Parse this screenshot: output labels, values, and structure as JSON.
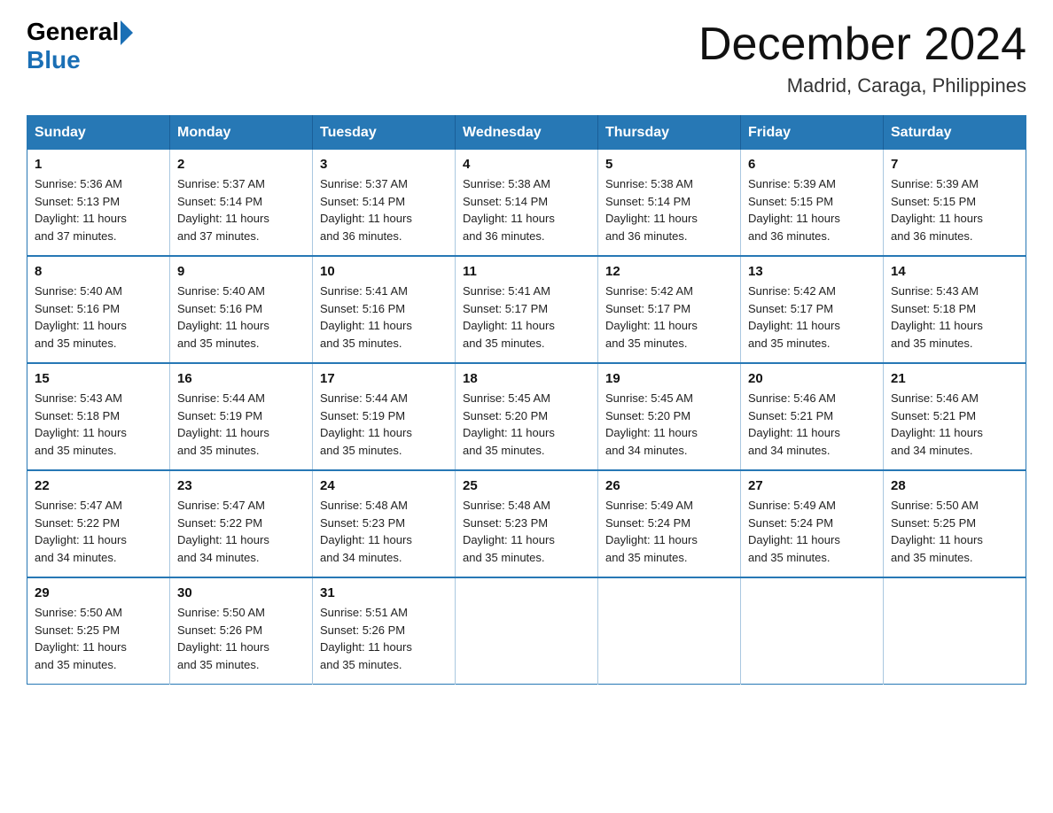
{
  "logo": {
    "general": "General",
    "blue": "Blue"
  },
  "title": {
    "month_year": "December 2024",
    "location": "Madrid, Caraga, Philippines"
  },
  "header_days": [
    "Sunday",
    "Monday",
    "Tuesday",
    "Wednesday",
    "Thursday",
    "Friday",
    "Saturday"
  ],
  "weeks": [
    [
      {
        "day": "1",
        "sunrise": "5:36 AM",
        "sunset": "5:13 PM",
        "daylight": "11 hours and 37 minutes."
      },
      {
        "day": "2",
        "sunrise": "5:37 AM",
        "sunset": "5:14 PM",
        "daylight": "11 hours and 37 minutes."
      },
      {
        "day": "3",
        "sunrise": "5:37 AM",
        "sunset": "5:14 PM",
        "daylight": "11 hours and 36 minutes."
      },
      {
        "day": "4",
        "sunrise": "5:38 AM",
        "sunset": "5:14 PM",
        "daylight": "11 hours and 36 minutes."
      },
      {
        "day": "5",
        "sunrise": "5:38 AM",
        "sunset": "5:14 PM",
        "daylight": "11 hours and 36 minutes."
      },
      {
        "day": "6",
        "sunrise": "5:39 AM",
        "sunset": "5:15 PM",
        "daylight": "11 hours and 36 minutes."
      },
      {
        "day": "7",
        "sunrise": "5:39 AM",
        "sunset": "5:15 PM",
        "daylight": "11 hours and 36 minutes."
      }
    ],
    [
      {
        "day": "8",
        "sunrise": "5:40 AM",
        "sunset": "5:16 PM",
        "daylight": "11 hours and 35 minutes."
      },
      {
        "day": "9",
        "sunrise": "5:40 AM",
        "sunset": "5:16 PM",
        "daylight": "11 hours and 35 minutes."
      },
      {
        "day": "10",
        "sunrise": "5:41 AM",
        "sunset": "5:16 PM",
        "daylight": "11 hours and 35 minutes."
      },
      {
        "day": "11",
        "sunrise": "5:41 AM",
        "sunset": "5:17 PM",
        "daylight": "11 hours and 35 minutes."
      },
      {
        "day": "12",
        "sunrise": "5:42 AM",
        "sunset": "5:17 PM",
        "daylight": "11 hours and 35 minutes."
      },
      {
        "day": "13",
        "sunrise": "5:42 AM",
        "sunset": "5:17 PM",
        "daylight": "11 hours and 35 minutes."
      },
      {
        "day": "14",
        "sunrise": "5:43 AM",
        "sunset": "5:18 PM",
        "daylight": "11 hours and 35 minutes."
      }
    ],
    [
      {
        "day": "15",
        "sunrise": "5:43 AM",
        "sunset": "5:18 PM",
        "daylight": "11 hours and 35 minutes."
      },
      {
        "day": "16",
        "sunrise": "5:44 AM",
        "sunset": "5:19 PM",
        "daylight": "11 hours and 35 minutes."
      },
      {
        "day": "17",
        "sunrise": "5:44 AM",
        "sunset": "5:19 PM",
        "daylight": "11 hours and 35 minutes."
      },
      {
        "day": "18",
        "sunrise": "5:45 AM",
        "sunset": "5:20 PM",
        "daylight": "11 hours and 35 minutes."
      },
      {
        "day": "19",
        "sunrise": "5:45 AM",
        "sunset": "5:20 PM",
        "daylight": "11 hours and 34 minutes."
      },
      {
        "day": "20",
        "sunrise": "5:46 AM",
        "sunset": "5:21 PM",
        "daylight": "11 hours and 34 minutes."
      },
      {
        "day": "21",
        "sunrise": "5:46 AM",
        "sunset": "5:21 PM",
        "daylight": "11 hours and 34 minutes."
      }
    ],
    [
      {
        "day": "22",
        "sunrise": "5:47 AM",
        "sunset": "5:22 PM",
        "daylight": "11 hours and 34 minutes."
      },
      {
        "day": "23",
        "sunrise": "5:47 AM",
        "sunset": "5:22 PM",
        "daylight": "11 hours and 34 minutes."
      },
      {
        "day": "24",
        "sunrise": "5:48 AM",
        "sunset": "5:23 PM",
        "daylight": "11 hours and 34 minutes."
      },
      {
        "day": "25",
        "sunrise": "5:48 AM",
        "sunset": "5:23 PM",
        "daylight": "11 hours and 35 minutes."
      },
      {
        "day": "26",
        "sunrise": "5:49 AM",
        "sunset": "5:24 PM",
        "daylight": "11 hours and 35 minutes."
      },
      {
        "day": "27",
        "sunrise": "5:49 AM",
        "sunset": "5:24 PM",
        "daylight": "11 hours and 35 minutes."
      },
      {
        "day": "28",
        "sunrise": "5:50 AM",
        "sunset": "5:25 PM",
        "daylight": "11 hours and 35 minutes."
      }
    ],
    [
      {
        "day": "29",
        "sunrise": "5:50 AM",
        "sunset": "5:25 PM",
        "daylight": "11 hours and 35 minutes."
      },
      {
        "day": "30",
        "sunrise": "5:50 AM",
        "sunset": "5:26 PM",
        "daylight": "11 hours and 35 minutes."
      },
      {
        "day": "31",
        "sunrise": "5:51 AM",
        "sunset": "5:26 PM",
        "daylight": "11 hours and 35 minutes."
      },
      null,
      null,
      null,
      null
    ]
  ],
  "labels": {
    "sunrise": "Sunrise:",
    "sunset": "Sunset:",
    "daylight": "Daylight:"
  }
}
